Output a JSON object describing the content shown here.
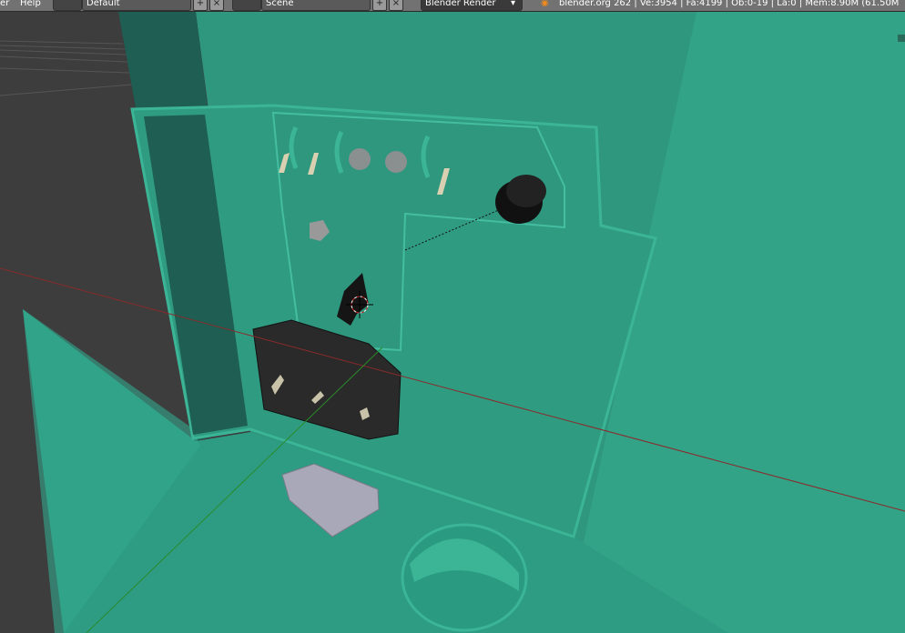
{
  "menu": {
    "items": [
      "er",
      "Help"
    ]
  },
  "screen_layout": {
    "value": "Default",
    "icon": "layout-icon"
  },
  "scene": {
    "value": "Scene",
    "icon": "scene-icon"
  },
  "render_engine": {
    "value": "Blender Render"
  },
  "stats": "blender.org 262 | Ve:3954 | Fa:4199 | Ob:0-19 | La:0 | Mem:8.90M (61.50M",
  "colors": {
    "teal": "#2f9a80",
    "dark_teal": "#1f5e52",
    "bg": "#3d3d3d"
  }
}
